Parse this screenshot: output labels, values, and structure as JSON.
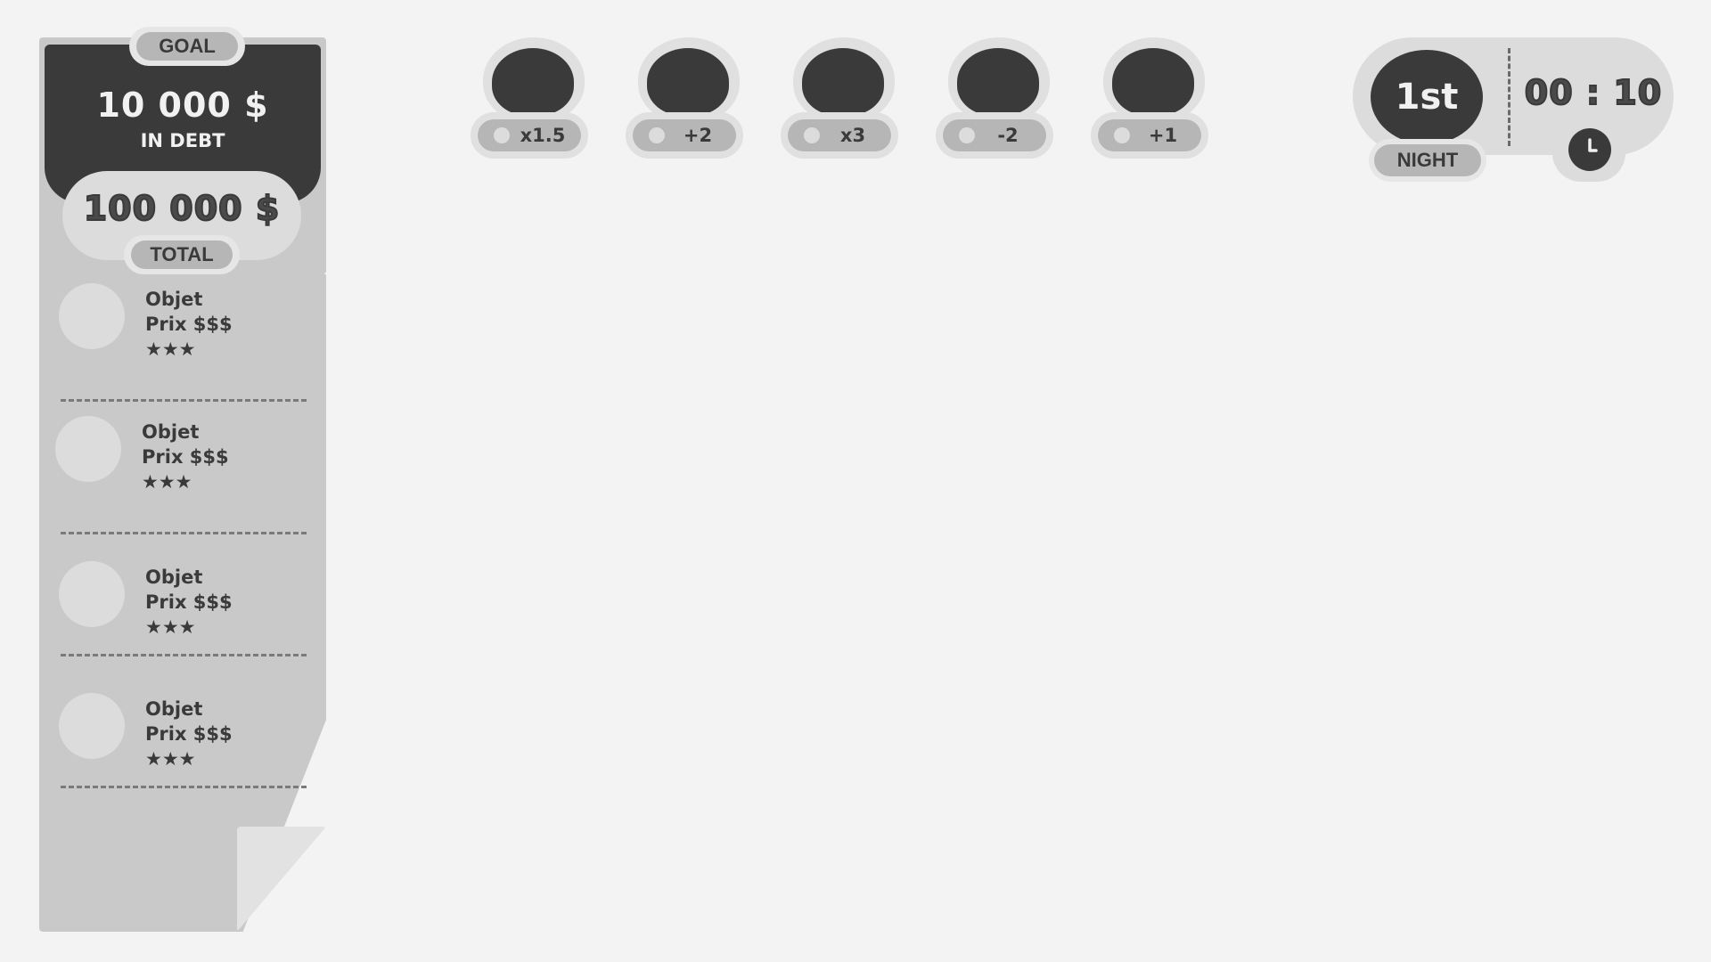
{
  "goal": {
    "tab_label": "GOAL",
    "amount": "10 000 $",
    "subtitle": "IN DEBT"
  },
  "total": {
    "amount": "100 000 $",
    "tab_label": "TOTAL"
  },
  "items": [
    {
      "name": "Objet",
      "price": "Prix $$$",
      "rating": "★★★"
    },
    {
      "name": "Objet",
      "price": "Prix $$$",
      "rating": "★★★"
    },
    {
      "name": "Objet",
      "price": "Prix $$$",
      "rating": "★★★"
    },
    {
      "name": "Objet",
      "price": "Prix $$$",
      "rating": "★★★"
    }
  ],
  "modifiers": [
    {
      "label": "x1.5"
    },
    {
      "label": "+2"
    },
    {
      "label": "x3"
    },
    {
      "label": "-2"
    },
    {
      "label": "+1"
    }
  ],
  "night": {
    "number": "1st",
    "label": "NIGHT"
  },
  "timer": {
    "value": "00 : 10",
    "icon": "clock-icon"
  },
  "colors": {
    "background": "#f3f3f3",
    "panel": "#c9c9c9",
    "dark": "#3a3a3a",
    "light": "#dcdcdc",
    "pill": "#b6b6b6"
  }
}
